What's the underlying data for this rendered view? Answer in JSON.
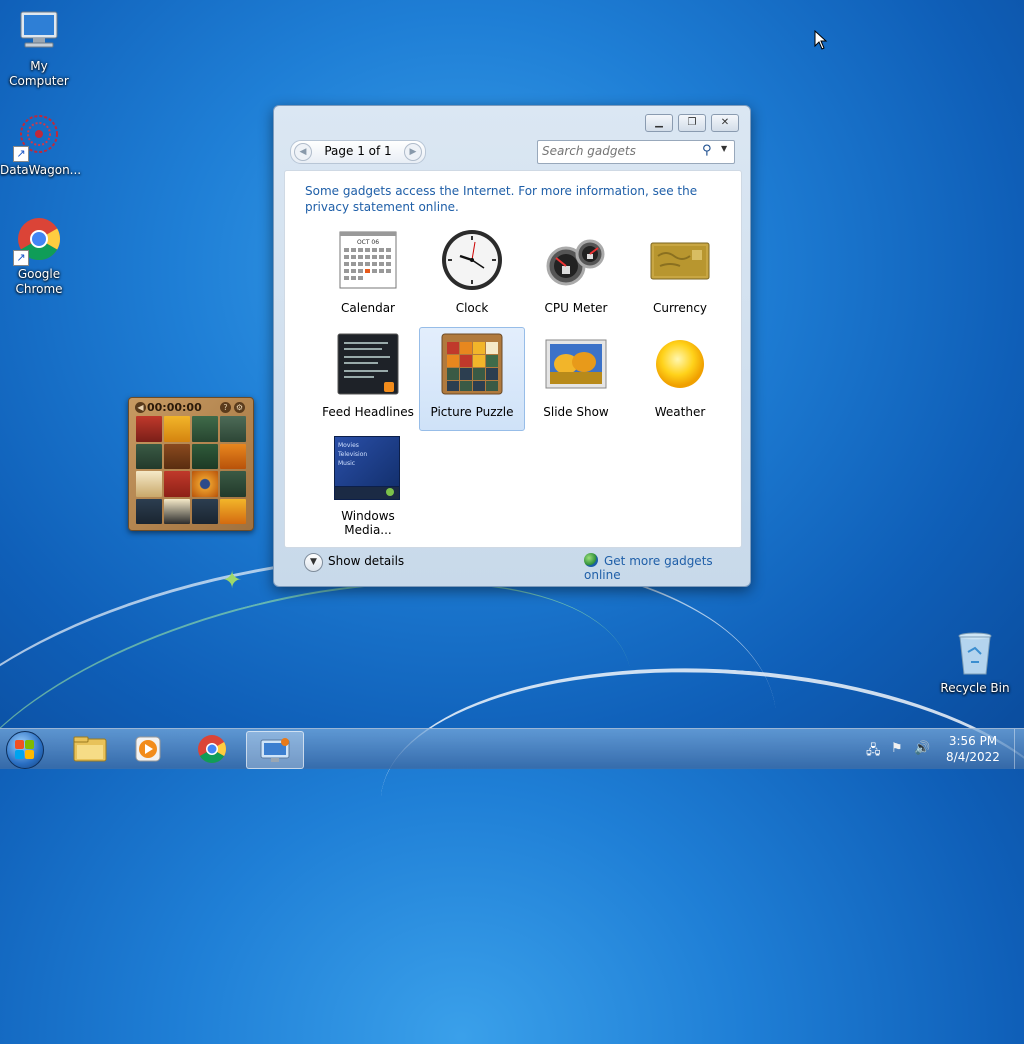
{
  "desktop": {
    "icons": [
      {
        "label": "My Computer",
        "icon": "computer-icon"
      },
      {
        "label": "DataWagon...",
        "icon": "datawagon-icon"
      },
      {
        "label": "Google Chrome",
        "icon": "chrome-icon"
      },
      {
        "label": "Recycle Bin",
        "icon": "recycle-bin-icon"
      }
    ]
  },
  "gadget_window": {
    "pager_label": "Page 1 of 1",
    "search_placeholder": "Search gadgets",
    "notice": "Some gadgets access the Internet.  For more information, see the privacy statement online.",
    "gadgets": [
      {
        "label": "Calendar",
        "icon": "calendar-icon",
        "selected": false
      },
      {
        "label": "Clock",
        "icon": "clock-icon",
        "selected": false
      },
      {
        "label": "CPU Meter",
        "icon": "cpu-meter-icon",
        "selected": false
      },
      {
        "label": "Currency",
        "icon": "currency-icon",
        "selected": false
      },
      {
        "label": "Feed Headlines",
        "icon": "feed-headlines-icon",
        "selected": false
      },
      {
        "label": "Picture Puzzle",
        "icon": "picture-puzzle-icon",
        "selected": true
      },
      {
        "label": "Slide Show",
        "icon": "slide-show-icon",
        "selected": false
      },
      {
        "label": "Weather",
        "icon": "weather-icon",
        "selected": false
      },
      {
        "label": "Windows Media...",
        "icon": "windows-media-icon",
        "selected": false
      }
    ],
    "calendar_month": "OCT 06",
    "media_lines": [
      "Movies",
      "Television",
      "Music"
    ],
    "show_details": "Show details",
    "get_more": "Get more gadgets online"
  },
  "puzzle_gadget": {
    "timer": "00:00:00"
  },
  "taskbar": {
    "time": "3:56 PM",
    "date": "8/4/2022"
  },
  "colors": {
    "accent_link": "#1f5fa8",
    "selection": "#cfe2f8"
  }
}
